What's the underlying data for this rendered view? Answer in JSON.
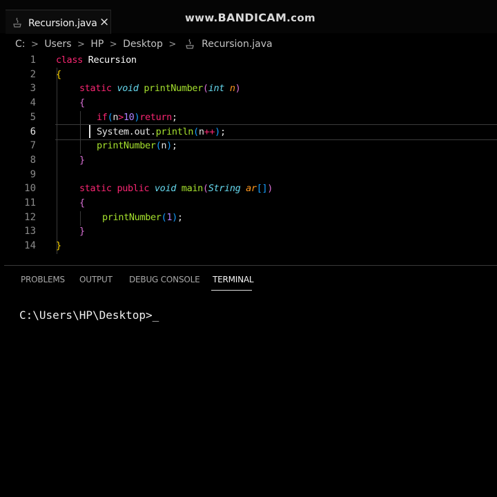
{
  "tab": {
    "filename": "Recursion.java",
    "close_icon": "×"
  },
  "watermark": {
    "prefix": "www.",
    "brand": "BANDICAM",
    "suffix": ".com"
  },
  "breadcrumb": {
    "items": [
      "C:",
      "Users",
      "HP",
      "Desktop"
    ],
    "file": "Recursion.java"
  },
  "editor": {
    "active_line": 6,
    "line_numbers": [
      "1",
      "2",
      "3",
      "4",
      "5",
      "6",
      "7",
      "8",
      "9",
      "10",
      "11",
      "12",
      "13",
      "14"
    ],
    "lines": [
      [
        {
          "t": "class ",
          "c": "kw"
        },
        {
          "t": "Recursion",
          "c": "cls"
        }
      ],
      [
        {
          "t": "{",
          "c": "br1"
        }
      ],
      [
        {
          "t": "static ",
          "c": "kw"
        },
        {
          "t": "void ",
          "c": "kw-i"
        },
        {
          "t": "printNumber",
          "c": "fn"
        },
        {
          "t": "(",
          "c": "br2"
        },
        {
          "t": "int ",
          "c": "ty"
        },
        {
          "t": "n",
          "c": "pa"
        },
        {
          "t": ")",
          "c": "br2"
        }
      ],
      [
        {
          "t": "{",
          "c": "br2"
        }
      ],
      [
        {
          "t": "if",
          "c": "kw"
        },
        {
          "t": "(",
          "c": "br3"
        },
        {
          "t": "n",
          "c": "pl"
        },
        {
          "t": ">",
          "c": "kw"
        },
        {
          "t": "10",
          "c": "num"
        },
        {
          "t": ")",
          "c": "br3"
        },
        {
          "t": "return",
          "c": "kw"
        },
        {
          "t": ";",
          "c": "pl"
        }
      ],
      [
        {
          "t": "System",
          "c": "pl"
        },
        {
          "t": ".",
          "c": "pl"
        },
        {
          "t": "out",
          "c": "pl"
        },
        {
          "t": ".",
          "c": "pl"
        },
        {
          "t": "println",
          "c": "fn"
        },
        {
          "t": "(",
          "c": "br3"
        },
        {
          "t": "n",
          "c": "pl"
        },
        {
          "t": "++",
          "c": "kw"
        },
        {
          "t": ")",
          "c": "br3"
        },
        {
          "t": ";",
          "c": "pl"
        }
      ],
      [
        {
          "t": "printNumber",
          "c": "fn"
        },
        {
          "t": "(",
          "c": "br3"
        },
        {
          "t": "n",
          "c": "pl"
        },
        {
          "t": ")",
          "c": "br3"
        },
        {
          "t": ";",
          "c": "pl"
        }
      ],
      [
        {
          "t": "}",
          "c": "br2"
        }
      ],
      [],
      [
        {
          "t": "static ",
          "c": "kw"
        },
        {
          "t": "public ",
          "c": "kw"
        },
        {
          "t": "void ",
          "c": "kw-i"
        },
        {
          "t": "main",
          "c": "fn"
        },
        {
          "t": "(",
          "c": "br2"
        },
        {
          "t": "String ",
          "c": "ty"
        },
        {
          "t": "ar",
          "c": "pa"
        },
        {
          "t": "[]",
          "c": "br3"
        },
        {
          "t": ")",
          "c": "br2"
        }
      ],
      [
        {
          "t": "{",
          "c": "br2"
        }
      ],
      [
        {
          "t": "printNumber",
          "c": "fn"
        },
        {
          "t": "(",
          "c": "br3"
        },
        {
          "t": "1",
          "c": "num"
        },
        {
          "t": ")",
          "c": "br3"
        },
        {
          "t": ";",
          "c": "pl"
        }
      ],
      [
        {
          "t": "}",
          "c": "br2"
        }
      ],
      [
        {
          "t": "}",
          "c": "br1"
        }
      ]
    ]
  },
  "panel": {
    "tabs": [
      "PROBLEMS",
      "OUTPUT",
      "DEBUG CONSOLE",
      "TERMINAL"
    ],
    "active_tab": "TERMINAL"
  },
  "terminal": {
    "prompt": "C:\\Users\\HP\\Desktop>_"
  },
  "colors": {
    "keyword": "#f92672",
    "type": "#66d9ef",
    "function": "#a6e22e",
    "parameter": "#fd971f",
    "number": "#ae81ff",
    "background": "#000000"
  },
  "icons": {
    "file_icon": "java-file-icon",
    "chevron": "chevron-right-icon",
    "close": "close-icon"
  }
}
